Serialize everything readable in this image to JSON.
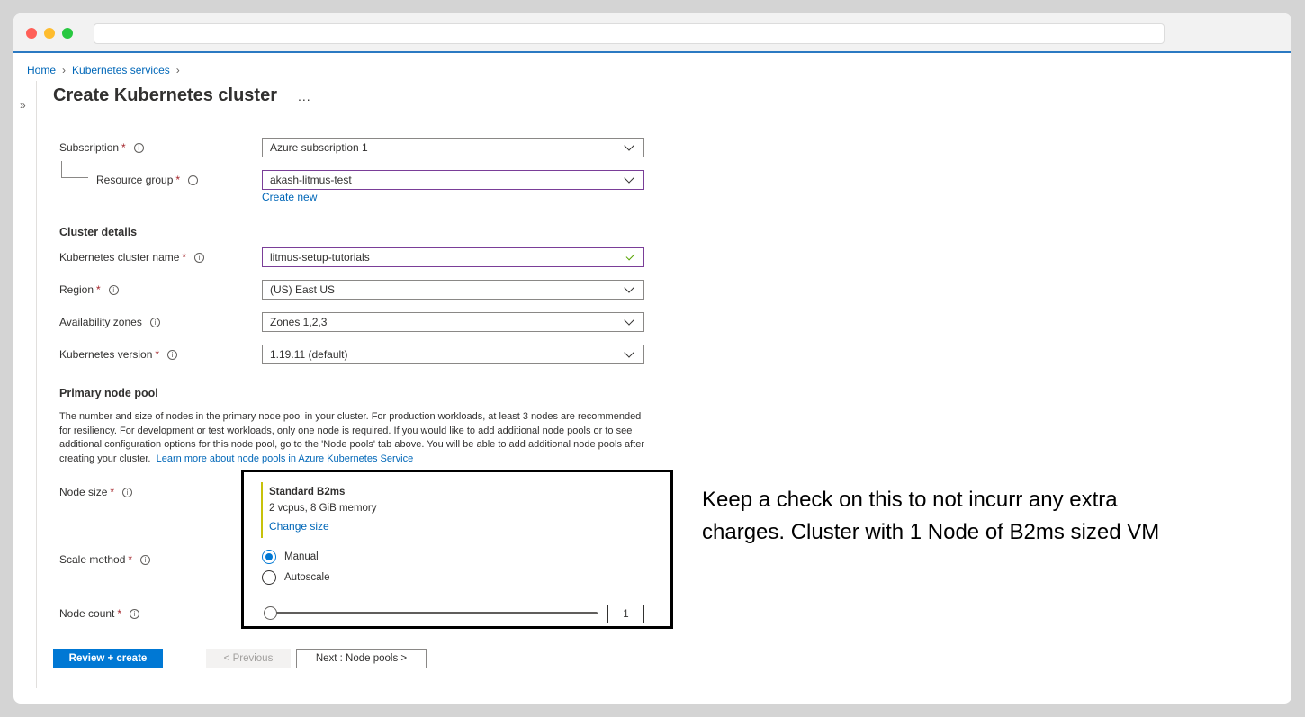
{
  "breadcrumb": {
    "home": "Home",
    "services": "Kubernetes services"
  },
  "page": {
    "title": "Create Kubernetes cluster",
    "more": "..."
  },
  "form": {
    "subscription": {
      "label": "Subscription",
      "value": "Azure subscription 1"
    },
    "resource_group": {
      "label": "Resource group",
      "value": "akash-litmus-test",
      "create_new": "Create new"
    },
    "cluster_details_heading": "Cluster details",
    "cluster_name": {
      "label": "Kubernetes cluster name",
      "value": "litmus-setup-tutorials"
    },
    "region": {
      "label": "Region",
      "value": "(US) East US"
    },
    "availability_zones": {
      "label": "Availability zones",
      "value": "Zones 1,2,3"
    },
    "k8s_version": {
      "label": "Kubernetes version",
      "value": "1.19.11 (default)"
    },
    "primary_pool_heading": "Primary node pool",
    "primary_pool_desc": "The number and size of nodes in the primary node pool in your cluster. For production workloads, at least 3 nodes are recommended for resiliency. For development or test workloads, only one node is required. If you would like to add additional node pools or to see additional configuration options for this node pool, go to the 'Node pools' tab above. You will be able to add additional node pools after creating your cluster.",
    "primary_pool_link": "Learn more about node pools in Azure Kubernetes Service",
    "node_size": {
      "label": "Node size",
      "name": "Standard B2ms",
      "spec": "2 vcpus, 8 GiB memory",
      "change": "Change size"
    },
    "scale_method": {
      "label": "Scale method",
      "options": [
        "Manual",
        "Autoscale"
      ],
      "selected": "Manual"
    },
    "node_count": {
      "label": "Node count",
      "value": "1"
    }
  },
  "annotation": "Keep a check on this to not incurr any extra charges. Cluster with 1 Node of B2ms sized VM",
  "footer": {
    "review": "Review + create",
    "previous": "< Previous",
    "next": "Next : Node pools >"
  },
  "icons": {
    "info": "info-icon",
    "chevron": "chevron-down-icon",
    "check": "checkmark-icon",
    "expand": "double-chevron-right-icon"
  },
  "colors": {
    "accent": "#0078d4",
    "link": "#0067b8",
    "required": "#a4262c",
    "valid": "#57a300"
  }
}
